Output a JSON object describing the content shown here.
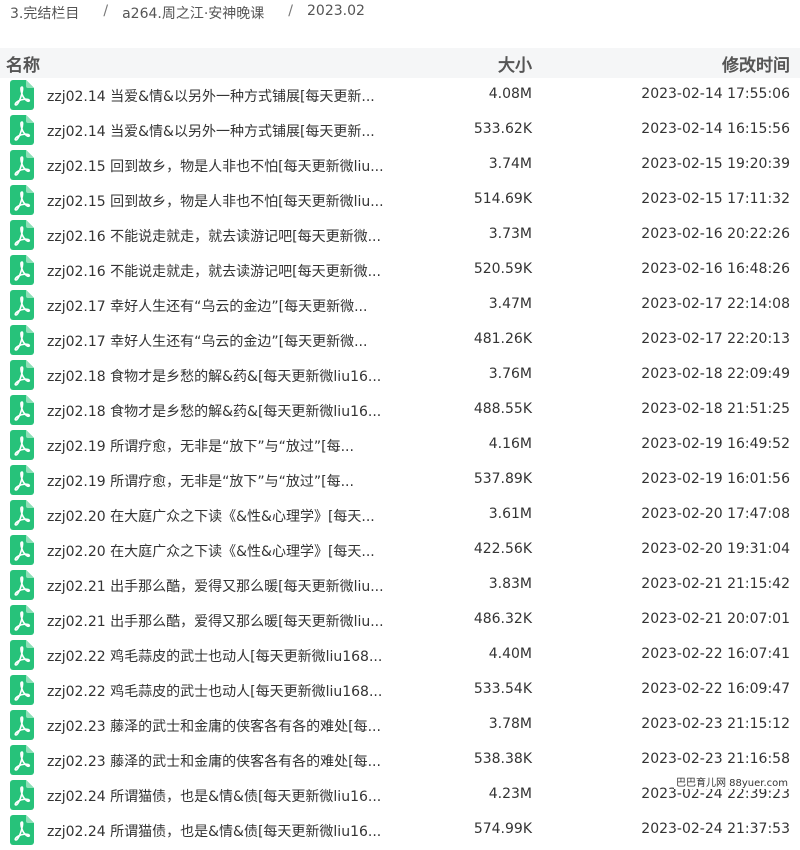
{
  "breadcrumb": [
    "3.完结栏目",
    "a264.周之江·安神晚课",
    "2023.02"
  ],
  "breadcrumb_separator": "/",
  "columns": {
    "name": "名称",
    "size": "大小",
    "time": "修改时间"
  },
  "icon": "pdf-file-icon",
  "colors": {
    "icon_bg": "#27c27a",
    "header_bg": "#f5f6f7"
  },
  "files": [
    {
      "name": "zzj02.14 当爱&情&以另外一种方式铺展[每天更新...",
      "size": "4.08M",
      "time": "2023-02-14 17:55:06"
    },
    {
      "name": "zzj02.14 当爱&情&以另外一种方式铺展[每天更新...",
      "size": "533.62K",
      "time": "2023-02-14 16:15:56"
    },
    {
      "name": "zzj02.15 回到故乡，物是人非也不怕[每天更新微liu...",
      "size": "3.74M",
      "time": "2023-02-15 19:20:39"
    },
    {
      "name": "zzj02.15 回到故乡，物是人非也不怕[每天更新微liu...",
      "size": "514.69K",
      "time": "2023-02-15 17:11:32"
    },
    {
      "name": "zzj02.16 不能说走就走，就去读游记吧[每天更新微...",
      "size": "3.73M",
      "time": "2023-02-16 20:22:26"
    },
    {
      "name": "zzj02.16 不能说走就走，就去读游记吧[每天更新微...",
      "size": "520.59K",
      "time": "2023-02-16 16:48:26"
    },
    {
      "name": "zzj02.17 幸好人生还有“乌云的金边”[每天更新微...",
      "size": "3.47M",
      "time": "2023-02-17 22:14:08"
    },
    {
      "name": "zzj02.17 幸好人生还有“乌云的金边”[每天更新微...",
      "size": "481.26K",
      "time": "2023-02-17 22:20:13"
    },
    {
      "name": "zzj02.18 食物才是乡愁的解&药&[每天更新微liu16...",
      "size": "3.76M",
      "time": "2023-02-18 22:09:49"
    },
    {
      "name": "zzj02.18 食物才是乡愁的解&药&[每天更新微liu16...",
      "size": "488.55K",
      "time": "2023-02-18 21:51:25"
    },
    {
      "name": "zzj02.19 所谓疗愈，无非是“放下”与“放过”[每...",
      "size": "4.16M",
      "time": "2023-02-19 16:49:52"
    },
    {
      "name": "zzj02.19 所谓疗愈，无非是“放下”与“放过”[每...",
      "size": "537.89K",
      "time": "2023-02-19 16:01:56"
    },
    {
      "name": "zzj02.20 在大庭广众之下读《&性&心理学》[每天...",
      "size": "3.61M",
      "time": "2023-02-20 17:47:08"
    },
    {
      "name": "zzj02.20 在大庭广众之下读《&性&心理学》[每天...",
      "size": "422.56K",
      "time": "2023-02-20 19:31:04"
    },
    {
      "name": "zzj02.21 出手那么酷，爱得又那么暖[每天更新微liu...",
      "size": "3.83M",
      "time": "2023-02-21 21:15:42"
    },
    {
      "name": "zzj02.21 出手那么酷，爱得又那么暖[每天更新微liu...",
      "size": "486.32K",
      "time": "2023-02-21 20:07:01"
    },
    {
      "name": "zzj02.22 鸡毛蒜皮的武士也动人[每天更新微liu168...",
      "size": "4.40M",
      "time": "2023-02-22 16:07:41"
    },
    {
      "name": "zzj02.22 鸡毛蒜皮的武士也动人[每天更新微liu168...",
      "size": "533.54K",
      "time": "2023-02-22 16:09:47"
    },
    {
      "name": "zzj02.23 藤泽的武士和金庸的侠客各有各的难处[每...",
      "size": "3.78M",
      "time": "2023-02-23 21:15:12"
    },
    {
      "name": "zzj02.23 藤泽的武士和金庸的侠客各有各的难处[每...",
      "size": "538.38K",
      "time": "2023-02-23 21:16:58"
    },
    {
      "name": "zzj02.24 所谓猫债，也是&情&债[每天更新微liu16...",
      "size": "4.23M",
      "time": "2023-02-24 22:39:23"
    },
    {
      "name": "zzj02.24 所谓猫债，也是&情&债[每天更新微liu16...",
      "size": "574.99K",
      "time": "2023-02-24 21:37:53"
    }
  ],
  "watermark": "巴巴育儿网 88yuer.com"
}
